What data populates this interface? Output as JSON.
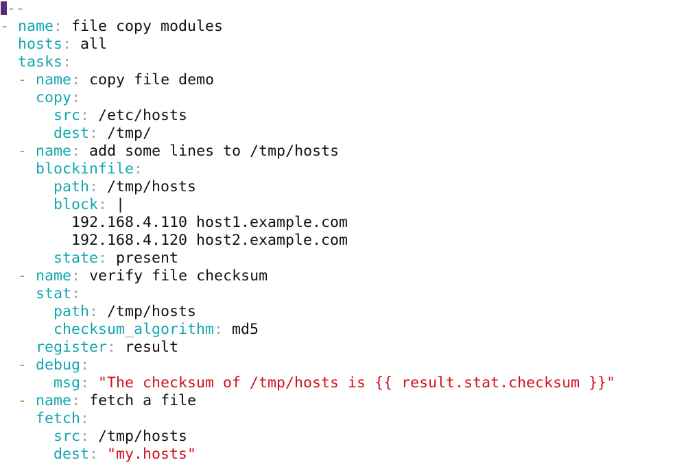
{
  "colors": {
    "dash": "#d9822b",
    "key": "#11a7b0",
    "string": "#d0111a",
    "text": "#111111",
    "cursor": "#5b2a78",
    "punct": "#9aa0a6"
  },
  "lines": [
    {
      "indent": "",
      "parts": [
        {
          "cls": "docstart",
          "text": "--"
        }
      ],
      "cursor": true
    },
    {
      "indent": "",
      "parts": [
        {
          "cls": "dash",
          "text": "- "
        },
        {
          "cls": "key",
          "text": "name"
        },
        {
          "cls": "colon",
          "text": ": "
        },
        {
          "cls": "val",
          "text": "file copy modules"
        }
      ]
    },
    {
      "indent": "  ",
      "parts": [
        {
          "cls": "key",
          "text": "hosts"
        },
        {
          "cls": "colon",
          "text": ": "
        },
        {
          "cls": "val",
          "text": "all"
        }
      ]
    },
    {
      "indent": "  ",
      "parts": [
        {
          "cls": "key",
          "text": "tasks"
        },
        {
          "cls": "colon",
          "text": ":"
        }
      ]
    },
    {
      "indent": "  ",
      "parts": [
        {
          "cls": "dash",
          "text": "- "
        },
        {
          "cls": "key",
          "text": "name"
        },
        {
          "cls": "colon",
          "text": ": "
        },
        {
          "cls": "val",
          "text": "copy file demo"
        }
      ]
    },
    {
      "indent": "    ",
      "parts": [
        {
          "cls": "key",
          "text": "copy"
        },
        {
          "cls": "colon",
          "text": ":"
        }
      ]
    },
    {
      "indent": "      ",
      "parts": [
        {
          "cls": "key",
          "text": "src"
        },
        {
          "cls": "colon",
          "text": ": "
        },
        {
          "cls": "val",
          "text": "/etc/hosts"
        }
      ]
    },
    {
      "indent": "      ",
      "parts": [
        {
          "cls": "key",
          "text": "dest"
        },
        {
          "cls": "colon",
          "text": ": "
        },
        {
          "cls": "val",
          "text": "/tmp/"
        }
      ]
    },
    {
      "indent": "  ",
      "parts": [
        {
          "cls": "dash",
          "text": "- "
        },
        {
          "cls": "key",
          "text": "name"
        },
        {
          "cls": "colon",
          "text": ": "
        },
        {
          "cls": "val",
          "text": "add some lines to /tmp/hosts"
        }
      ]
    },
    {
      "indent": "    ",
      "parts": [
        {
          "cls": "key",
          "text": "blockinfile"
        },
        {
          "cls": "colon",
          "text": ":"
        }
      ]
    },
    {
      "indent": "      ",
      "parts": [
        {
          "cls": "key",
          "text": "path"
        },
        {
          "cls": "colon",
          "text": ": "
        },
        {
          "cls": "val",
          "text": "/tmp/hosts"
        }
      ]
    },
    {
      "indent": "      ",
      "parts": [
        {
          "cls": "key",
          "text": "block"
        },
        {
          "cls": "colon",
          "text": ": "
        },
        {
          "cls": "val",
          "text": "|"
        }
      ]
    },
    {
      "indent": "        ",
      "parts": [
        {
          "cls": "val",
          "text": "192.168.4.110 host1.example.com"
        }
      ]
    },
    {
      "indent": "        ",
      "parts": [
        {
          "cls": "val",
          "text": "192.168.4.120 host2.example.com"
        }
      ]
    },
    {
      "indent": "      ",
      "parts": [
        {
          "cls": "key",
          "text": "state"
        },
        {
          "cls": "colon",
          "text": ": "
        },
        {
          "cls": "val",
          "text": "present"
        }
      ]
    },
    {
      "indent": "  ",
      "parts": [
        {
          "cls": "dash",
          "text": "- "
        },
        {
          "cls": "key",
          "text": "name"
        },
        {
          "cls": "colon",
          "text": ": "
        },
        {
          "cls": "val",
          "text": "verify file checksum"
        }
      ]
    },
    {
      "indent": "    ",
      "parts": [
        {
          "cls": "key",
          "text": "stat"
        },
        {
          "cls": "colon",
          "text": ":"
        }
      ]
    },
    {
      "indent": "      ",
      "parts": [
        {
          "cls": "key",
          "text": "path"
        },
        {
          "cls": "colon",
          "text": ": "
        },
        {
          "cls": "val",
          "text": "/tmp/hosts"
        }
      ]
    },
    {
      "indent": "      ",
      "parts": [
        {
          "cls": "key",
          "text": "checksum_algorithm"
        },
        {
          "cls": "colon",
          "text": ": "
        },
        {
          "cls": "val",
          "text": "md5"
        }
      ]
    },
    {
      "indent": "    ",
      "parts": [
        {
          "cls": "key",
          "text": "register"
        },
        {
          "cls": "colon",
          "text": ": "
        },
        {
          "cls": "val",
          "text": "result"
        }
      ]
    },
    {
      "indent": "  ",
      "parts": [
        {
          "cls": "dash",
          "text": "- "
        },
        {
          "cls": "key",
          "text": "debug"
        },
        {
          "cls": "colon",
          "text": ":"
        }
      ]
    },
    {
      "indent": "      ",
      "parts": [
        {
          "cls": "key",
          "text": "msg"
        },
        {
          "cls": "colon",
          "text": ": "
        },
        {
          "cls": "str",
          "text": "\"The checksum of /tmp/hosts is {{ result.stat.checksum }}\""
        }
      ]
    },
    {
      "indent": "  ",
      "parts": [
        {
          "cls": "dash",
          "text": "- "
        },
        {
          "cls": "key",
          "text": "name"
        },
        {
          "cls": "colon",
          "text": ": "
        },
        {
          "cls": "val",
          "text": "fetch a file"
        }
      ]
    },
    {
      "indent": "    ",
      "parts": [
        {
          "cls": "key",
          "text": "fetch"
        },
        {
          "cls": "colon",
          "text": ":"
        }
      ]
    },
    {
      "indent": "      ",
      "parts": [
        {
          "cls": "key",
          "text": "src"
        },
        {
          "cls": "colon",
          "text": ": "
        },
        {
          "cls": "val",
          "text": "/tmp/hosts"
        }
      ]
    },
    {
      "indent": "      ",
      "parts": [
        {
          "cls": "key",
          "text": "dest"
        },
        {
          "cls": "colon",
          "text": ": "
        },
        {
          "cls": "str",
          "text": "\"my.hosts\""
        }
      ]
    }
  ]
}
